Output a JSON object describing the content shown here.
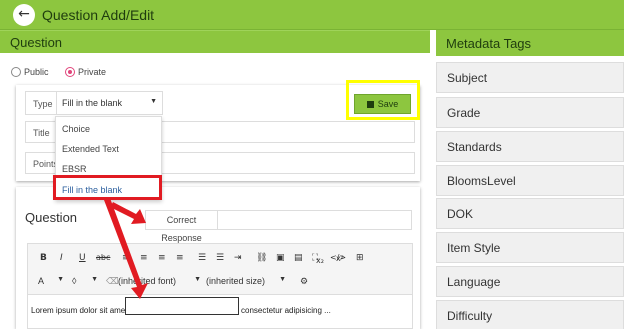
{
  "topbar": {
    "title": "Question Add/Edit",
    "back_icon": "arrow-left-icon"
  },
  "question_panel": {
    "header": "Question"
  },
  "visibility": {
    "options": [
      "Public",
      "Private"
    ],
    "selected": "Private"
  },
  "form": {
    "type_label": "Type",
    "type_value": "Fill in the blank",
    "title_label": "Title",
    "points_label": "Points"
  },
  "type_dropdown": {
    "options": [
      "Choice",
      "Extended Text",
      "EBSR",
      "Fill in the blank"
    ],
    "selected": "Fill in the blank"
  },
  "save_label": "Save",
  "editor": {
    "section_title": "Question",
    "correct_response_label": "Correct Response",
    "font_select": "(inherited font)",
    "size_select": "(inherited size)",
    "text_before": "Lorem ipsum dolor sit amet,",
    "text_after": "consectetur adipisicing ...",
    "toolbar_buttons": [
      "B",
      "I",
      "U",
      "abc",
      "≡",
      "≡",
      "≡",
      "≡",
      "☰",
      "☰",
      "⇥",
      "⛓",
      "▣",
      "▤",
      "⛶",
      "</>",
      "x₂",
      "x²",
      "⊞"
    ]
  },
  "metadata": {
    "header": "Metadata Tags",
    "items": [
      "Subject",
      "Grade",
      "Standards",
      "BloomsLevel",
      "DOK",
      "Item Style",
      "Language",
      "Difficulty"
    ]
  },
  "colors": {
    "brand_green": "#8dc63f",
    "highlight_yellow": "#ffff00",
    "highlight_red": "#e11b22",
    "radio_pink": "#e0457b"
  }
}
